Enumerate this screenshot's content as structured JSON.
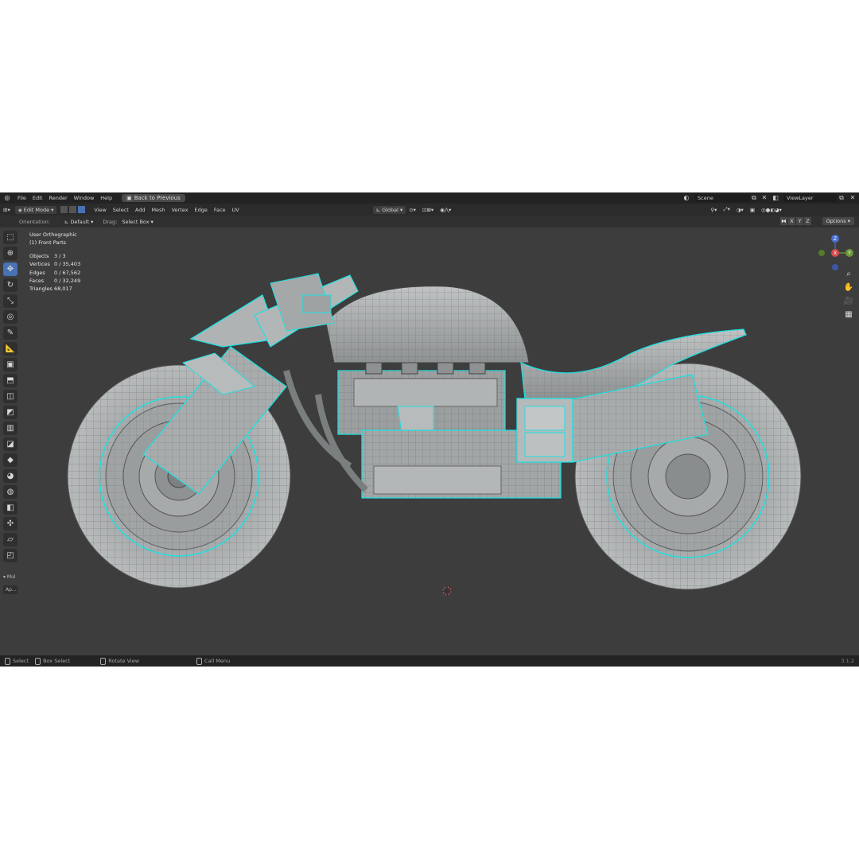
{
  "menu": {
    "file": "File",
    "edit": "Edit",
    "render": "Render",
    "window": "Window",
    "help": "Help",
    "back_to_previous": "Back to Previous"
  },
  "scene": {
    "scene_name": "Scene",
    "view_layer": "ViewLayer"
  },
  "header": {
    "mode": "Edit Mode",
    "view": "View",
    "select": "Select",
    "add": "Add",
    "mesh": "Mesh",
    "vertex": "Vertex",
    "edge": "Edge",
    "face": "Face",
    "uv": "UV",
    "transform_orientation": "Global"
  },
  "tool_settings": {
    "orientation_label": "Orientation:",
    "orientation_value": "Default",
    "drag_label": "Drag:",
    "drag_value": "Select Box",
    "axis_x": "X",
    "axis_y": "Y",
    "axis_z": "Z",
    "options": "Options"
  },
  "viewport_overlay": {
    "view_name": "User Orthographic",
    "collection": "(1) Front Parts",
    "stats": [
      {
        "label": "Objects",
        "value": "3 / 3"
      },
      {
        "label": "Vertices",
        "value": "0 / 35,403"
      },
      {
        "label": "Edges",
        "value": "0 / 67,562"
      },
      {
        "label": "Faces",
        "value": "0 / 32,249"
      },
      {
        "label": "Triangles",
        "value": "68,017"
      }
    ]
  },
  "gizmo": {
    "z": "Z",
    "x": "X",
    "y": "Y"
  },
  "last_operator": {
    "title": "Mul",
    "button": "Ap..."
  },
  "status_bar": {
    "select": "Select",
    "box_select": "Box Select",
    "rotate_view": "Rotate View",
    "call_menu": "Call Menu",
    "version": "3.1.2"
  },
  "colors": {
    "selection_cyan": "#1ee0e0",
    "active_blue": "#4772b3",
    "viewport_bg": "#3d3d3d",
    "mesh_gray": "#a6a9aa"
  }
}
